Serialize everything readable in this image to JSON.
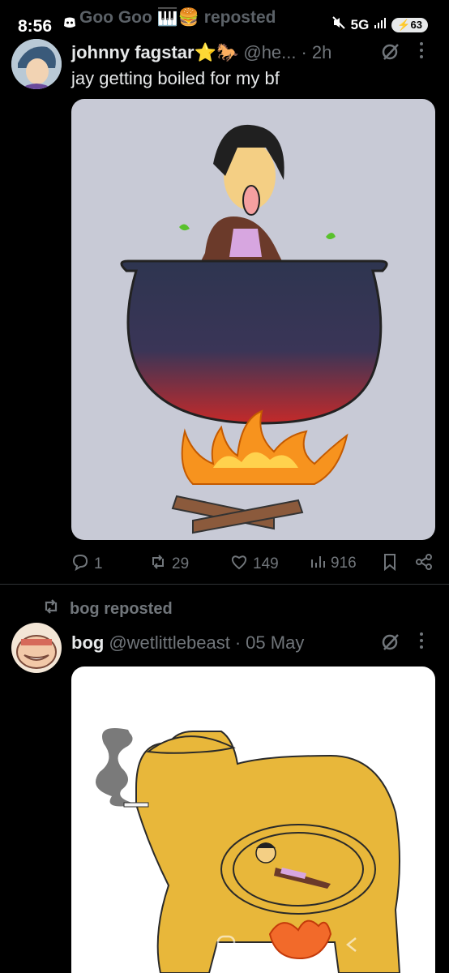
{
  "status_bar": {
    "time": "8:56",
    "notification_icon": "discord-icon",
    "network": "5G",
    "battery": "63"
  },
  "ghost_header": {
    "text": "Goo Goo 🎹🍔 reposted"
  },
  "post1": {
    "display_name": "johnny fagstar⭐🐎",
    "handle": "@he...",
    "time": "2h",
    "text": "jay getting boiled for my bf",
    "replies": "1",
    "reposts": "29",
    "likes": "149",
    "views": "916"
  },
  "post2": {
    "repost_label": "bog reposted",
    "display_name": "bog",
    "handle": "@wetlittlebeast",
    "time": "05 May"
  },
  "colors": {
    "background": "#000000",
    "text_primary": "#e7e9ea",
    "text_secondary": "#71767b",
    "divider": "#2f3336",
    "art_bg": "#c8cad6",
    "cauldron_top": "#2e3550",
    "cauldron_bottom": "#c42a2a",
    "fire": "#f7931e",
    "beast": "#e8b73a"
  }
}
